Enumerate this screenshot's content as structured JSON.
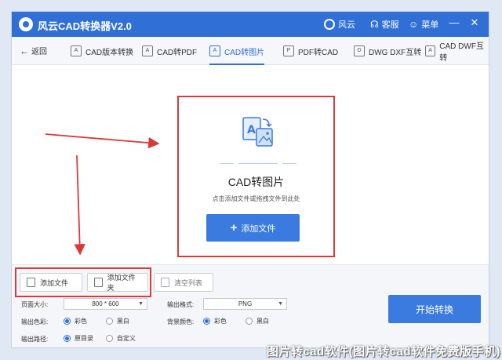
{
  "app": {
    "title": "风云CAD转换器V2.0"
  },
  "titlebar": {
    "brand_label": "风云",
    "service_label": "客服",
    "menu_label": "菜单",
    "minimize": "—",
    "close": "✕"
  },
  "nav": {
    "back_label": "返回",
    "tabs": [
      {
        "label": "CAD版本转换"
      },
      {
        "label": "CAD转PDF"
      },
      {
        "label": "CAD转图片"
      },
      {
        "label": "PDF转CAD"
      },
      {
        "label": "DWG DXF互转"
      },
      {
        "label": "CAD DWF互转"
      }
    ]
  },
  "dropzone": {
    "title": "CAD转图片",
    "subtitle": "点击添加文件或拖拽文件到此处",
    "add_button": "添加文件"
  },
  "actions": {
    "add_file": "添加文件",
    "add_folder": "添加文件夹",
    "clear_list": "清空列表"
  },
  "settings": {
    "page_size_label": "页面大小:",
    "page_size_value": "800 * 600",
    "output_format_label": "输出格式:",
    "output_format_value": "PNG",
    "output_color_label": "输出色彩:",
    "color_options": [
      "彩色",
      "黑白"
    ],
    "bg_color_label": "背景颜色:",
    "bg_options": [
      "彩色",
      "黑白"
    ],
    "output_path_label": "输出路径:",
    "path_options": [
      "原目录",
      "自定义"
    ]
  },
  "start_button": "开始转换",
  "watermark": "图片转cad软件(图片转cad软件免费版手机)",
  "colors": {
    "accent": "#2f6fd6",
    "highlight": "#d83a3a"
  }
}
